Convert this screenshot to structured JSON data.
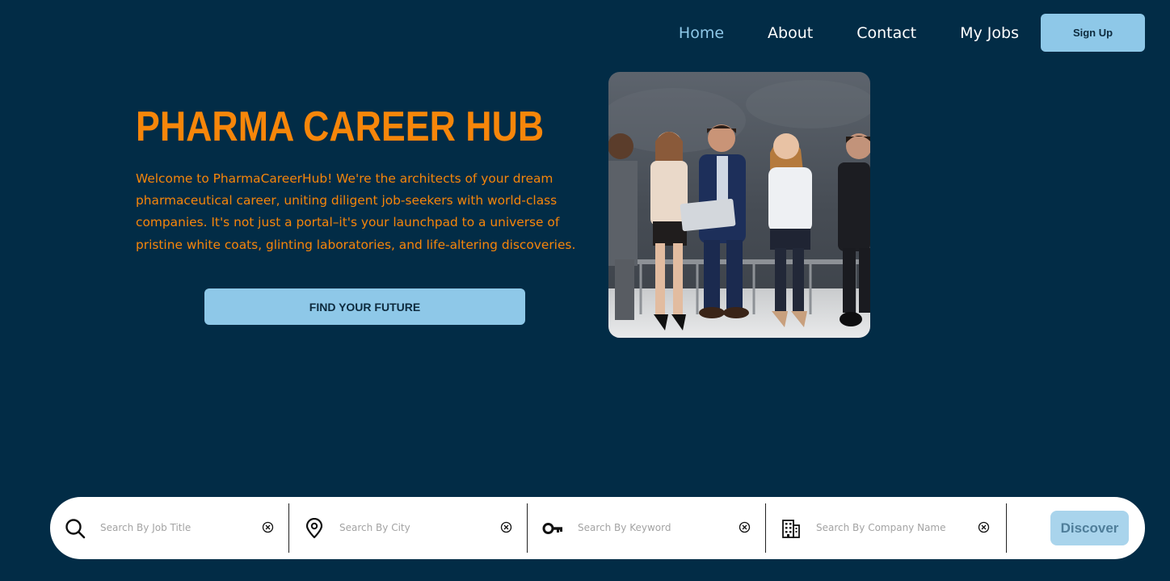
{
  "nav": {
    "links": [
      {
        "label": "Home",
        "active": true
      },
      {
        "label": "About",
        "active": false
      },
      {
        "label": "Contact",
        "active": false
      },
      {
        "label": "My Jobs",
        "active": false
      }
    ],
    "signup_label": "Sign Up"
  },
  "hero": {
    "title": "PHARMA CAREER HUB",
    "description": "Welcome to PharmaCareerHub! We're the architects of your dream pharmaceutical career, uniting diligent job-seekers with world-class companies. It's not just a portal–it's your launchpad to a universe of pristine white coats, glinting laboratories, and life-altering discoveries.",
    "cta_label": "FIND YOUR FUTURE"
  },
  "search": {
    "fields": [
      {
        "icon": "search-icon",
        "placeholder": "Search By Job Title",
        "value": ""
      },
      {
        "icon": "map-pin-icon",
        "placeholder": "Search By City",
        "value": ""
      },
      {
        "icon": "key-icon",
        "placeholder": "Search By Keyword",
        "value": ""
      },
      {
        "icon": "building-icon",
        "placeholder": "Search By Company Name",
        "value": ""
      }
    ],
    "button_label": "Discover"
  },
  "colors": {
    "background": "#022c46",
    "accent_orange": "#f7860a",
    "light_blue": "#8ec8e8",
    "nav_active": "#8ec8e8",
    "white": "#ffffff"
  }
}
